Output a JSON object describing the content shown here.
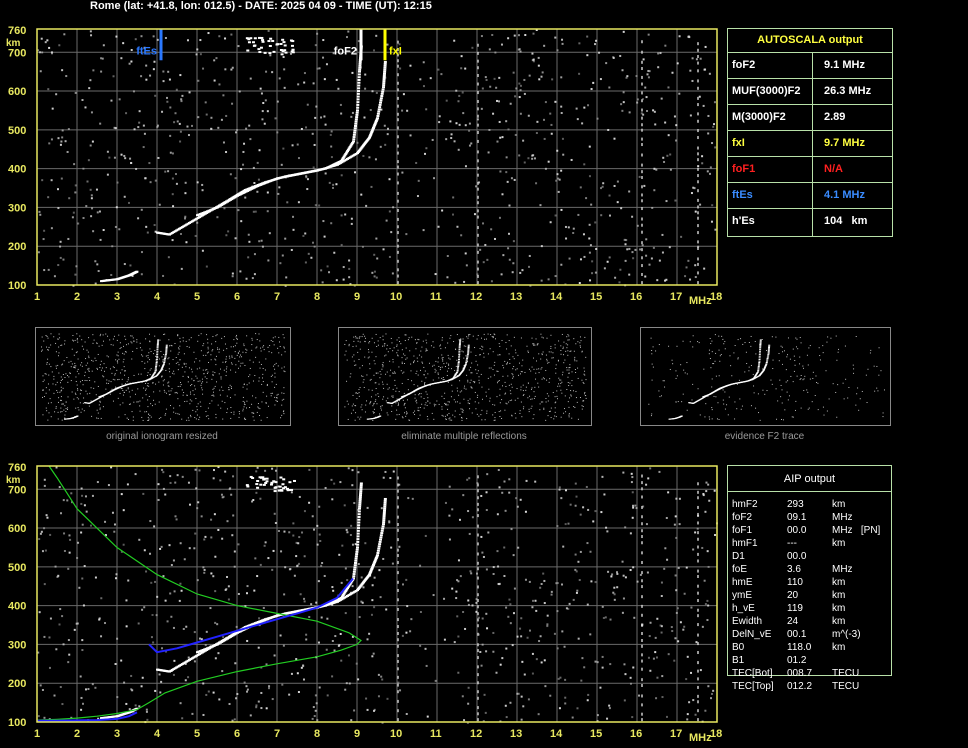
{
  "header": "Rome (lat: +41.8, lon: 012.5) - DATE: 2025 04 09 - TIME (UT): 12:15",
  "colors": {
    "axis": "#e8e860",
    "grid": "#6a6a6a",
    "trace": "#ffffff",
    "noise": "#dcdcdc",
    "ftEs": "#2a78ff",
    "foF2": "#ffffff",
    "fxI": "#ffff00",
    "profile": "#22cc22",
    "model": "#2222ff",
    "panel_border": "#b8e0a8",
    "red": "#ff2020"
  },
  "axes": {
    "y_unit": "km",
    "x_unit": "MHz",
    "y_ticks": [
      "760",
      "700",
      "600",
      "500",
      "400",
      "300",
      "200",
      "100"
    ],
    "x_ticks": [
      "1",
      "2",
      "3",
      "4",
      "5",
      "6",
      "7",
      "8",
      "9",
      "10",
      "11",
      "12",
      "13",
      "14",
      "15",
      "16",
      "17",
      "18"
    ]
  },
  "chart_data": [
    {
      "type": "scatter",
      "title": "",
      "xlabel": "MHz",
      "ylabel": "km",
      "xlim": [
        1,
        18
      ],
      "ylim": [
        100,
        760
      ],
      "markers": [
        {
          "label": "ftEs",
          "x": 4.1
        },
        {
          "label": "foF2",
          "x": 9.1
        },
        {
          "label": "fxI",
          "x": 9.7
        }
      ],
      "series": [
        {
          "name": "",
          "x": [
            4.0,
            4.3,
            4.8,
            5.3,
            5.8,
            6.2,
            6.7,
            7.2,
            7.7,
            8.2,
            8.6,
            8.9,
            9.0,
            9.05,
            9.1
          ],
          "y": [
            235,
            230,
            260,
            290,
            320,
            345,
            365,
            380,
            390,
            400,
            420,
            470,
            550,
            650,
            720
          ]
        },
        {
          "name": "",
          "x": [
            5.0,
            5.5,
            6.0,
            6.5,
            7.0,
            7.5,
            8.0,
            8.5,
            9.0,
            9.3,
            9.5,
            9.65,
            9.7
          ],
          "y": [
            280,
            300,
            330,
            355,
            375,
            385,
            395,
            410,
            440,
            480,
            530,
            610,
            680
          ]
        },
        {
          "name": "",
          "x": [
            2.6,
            3.0,
            3.3,
            3.5
          ],
          "y": [
            110,
            115,
            125,
            135
          ]
        }
      ]
    },
    {
      "type": "line",
      "title": "",
      "xlabel": "MHz",
      "ylabel": "km",
      "xlim": [
        1,
        18
      ],
      "ylim": [
        100,
        760
      ],
      "series": [
        {
          "name": "",
          "x": [
            1.0,
            1.5,
            2.0,
            2.5,
            3.0,
            3.5,
            3.8,
            4.2,
            5.0,
            6.0,
            7.0,
            8.0,
            8.6,
            9.0,
            9.1,
            8.8,
            8.0,
            7.0,
            6.0,
            5.0,
            4.0,
            3.0,
            2.0,
            1.5,
            1.3
          ],
          "y": [
            105,
            107,
            110,
            115,
            122,
            132,
            150,
            175,
            205,
            230,
            250,
            268,
            285,
            300,
            310,
            330,
            360,
            380,
            400,
            430,
            480,
            550,
            650,
            730,
            760
          ]
        },
        {
          "name": "",
          "x": [
            3.8,
            4.0,
            4.5,
            5.0,
            5.5,
            6.0,
            6.5,
            7.0,
            7.5,
            8.0,
            8.5,
            8.9
          ],
          "y": [
            300,
            280,
            290,
            305,
            320,
            335,
            350,
            365,
            380,
            395,
            420,
            470
          ]
        },
        {
          "name": "",
          "x": [
            1.0,
            1.5,
            2.0,
            2.5,
            3.0,
            3.3,
            3.5
          ],
          "y": [
            103,
            103,
            104,
            105,
            108,
            115,
            125
          ]
        }
      ]
    }
  ],
  "autoscala": {
    "title": "AUTOSCALA output",
    "rows": [
      {
        "label": "foF2",
        "value": "9.1 MHz",
        "color": "#ffffff"
      },
      {
        "label": "MUF(3000)F2",
        "value": "26.3 MHz",
        "color": "#ffffff"
      },
      {
        "label": "M(3000)F2",
        "value": "2.89",
        "color": "#ffffff"
      },
      {
        "label": "fxI",
        "value": "9.7 MHz",
        "color": "#ffff40"
      },
      {
        "label": "foF1",
        "value": "N/A",
        "color": "#ff2020"
      },
      {
        "label": "ftEs",
        "value": "4.1 MHz",
        "color": "#3a8cff"
      },
      {
        "label": "h'Es",
        "value": "104   km",
        "color": "#ffffff"
      }
    ]
  },
  "thumbnails": [
    {
      "caption": "original ionogram resized"
    },
    {
      "caption": "eliminate multiple reflections"
    },
    {
      "caption": "evidence F2 trace"
    }
  ],
  "aip": {
    "title": "AIP output",
    "rows": [
      {
        "name": "hmF2",
        "value": "293",
        "unit": "km"
      },
      {
        "name": "foF2",
        "value": "09.1",
        "unit": "MHz"
      },
      {
        "name": "foF1",
        "value": "00.0",
        "unit": "MHz   [PN]"
      },
      {
        "name": "hmF1",
        "value": "---",
        "unit": "km"
      },
      {
        "name": "D1",
        "value": "00.0",
        "unit": ""
      },
      {
        "name": "foE",
        "value": "3.6",
        "unit": "MHz"
      },
      {
        "name": "hmE",
        "value": "110",
        "unit": "km"
      },
      {
        "name": "ymE",
        "value": "20",
        "unit": "km"
      },
      {
        "name": "h_vE",
        "value": "119",
        "unit": "km"
      },
      {
        "name": "Ewidth",
        "value": "24",
        "unit": "km"
      },
      {
        "name": "DelN_vE",
        "value": "00.1",
        "unit": "m^(-3)"
      },
      {
        "name": "B0",
        "value": "118.0",
        "unit": "km"
      },
      {
        "name": "B1",
        "value": "01.2",
        "unit": ""
      },
      {
        "name": "TEC[Bot]",
        "value": "008.7",
        "unit": "TECU"
      },
      {
        "name": "TEC[Top]",
        "value": "012.2",
        "unit": "TECU"
      }
    ]
  }
}
